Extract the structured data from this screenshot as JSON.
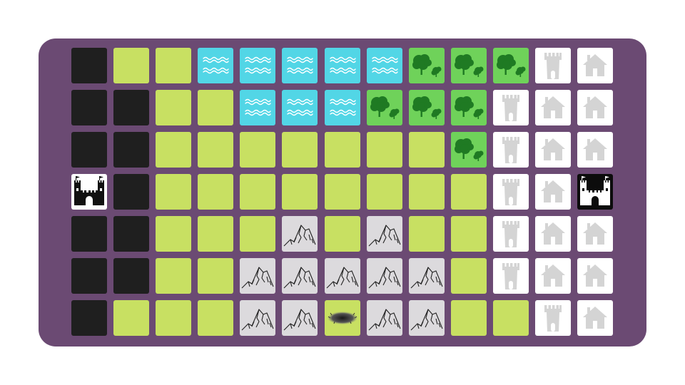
{
  "colors": {
    "board": "#6b4a73",
    "void": "#1f1f1f",
    "grass": "#c8e062",
    "water": "#52d6e6",
    "forest": "#6fd25a",
    "mountain": "#dcdadd",
    "building": "#ffffff",
    "building_icon": "#d4d4d4"
  },
  "legend": {
    "V": "void",
    "G": "grass",
    "W": "water",
    "F": "forest",
    "M": "mountain",
    "T": "tower",
    "H": "house",
    "C": "castle-white",
    "K": "castle-black",
    "P": "pit"
  },
  "board": {
    "columns": 13,
    "rows": [
      [
        "V",
        "G",
        "G",
        "W",
        "W",
        "W",
        "W",
        "W",
        "F",
        "F",
        "F",
        "T",
        "H"
      ],
      [
        "V",
        "V",
        "G",
        "G",
        "W",
        "W",
        "W",
        "F",
        "F",
        "F",
        "T",
        "H",
        "H"
      ],
      [
        "V",
        "V",
        "G",
        "G",
        "G",
        "G",
        "G",
        "G",
        "G",
        "F",
        "T",
        "H",
        "H"
      ],
      [
        "C",
        "V",
        "G",
        "G",
        "G",
        "G",
        "G",
        "G",
        "G",
        "G",
        "T",
        "H",
        "K"
      ],
      [
        "V",
        "V",
        "G",
        "G",
        "G",
        "M",
        "G",
        "M",
        "G",
        "G",
        "T",
        "H",
        "H"
      ],
      [
        "V",
        "V",
        "G",
        "G",
        "M",
        "M",
        "M",
        "M",
        "M",
        "G",
        "T",
        "H",
        "H"
      ],
      [
        "V",
        "G",
        "G",
        "G",
        "M",
        "M",
        "P",
        "M",
        "M",
        "G",
        "G",
        "T",
        "H"
      ]
    ]
  }
}
